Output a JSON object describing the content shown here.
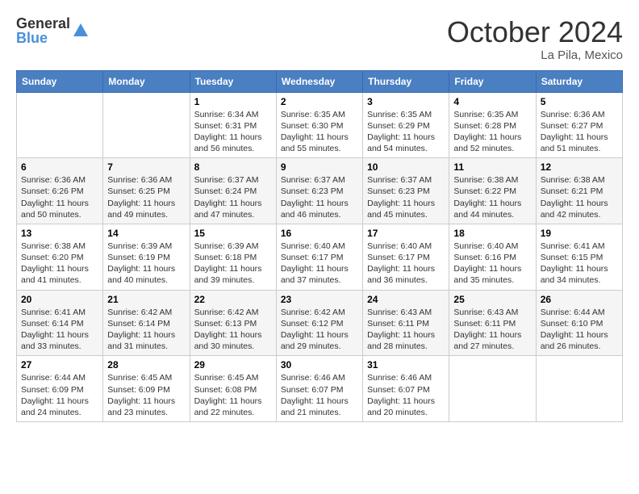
{
  "header": {
    "logo_general": "General",
    "logo_blue": "Blue",
    "title": "October 2024",
    "location": "La Pila, Mexico"
  },
  "days_of_week": [
    "Sunday",
    "Monday",
    "Tuesday",
    "Wednesday",
    "Thursday",
    "Friday",
    "Saturday"
  ],
  "weeks": [
    [
      {
        "day": null,
        "detail": null
      },
      {
        "day": null,
        "detail": null
      },
      {
        "day": "1",
        "sunrise": "Sunrise: 6:34 AM",
        "sunset": "Sunset: 6:31 PM",
        "daylight": "Daylight: 11 hours and 56 minutes."
      },
      {
        "day": "2",
        "sunrise": "Sunrise: 6:35 AM",
        "sunset": "Sunset: 6:30 PM",
        "daylight": "Daylight: 11 hours and 55 minutes."
      },
      {
        "day": "3",
        "sunrise": "Sunrise: 6:35 AM",
        "sunset": "Sunset: 6:29 PM",
        "daylight": "Daylight: 11 hours and 54 minutes."
      },
      {
        "day": "4",
        "sunrise": "Sunrise: 6:35 AM",
        "sunset": "Sunset: 6:28 PM",
        "daylight": "Daylight: 11 hours and 52 minutes."
      },
      {
        "day": "5",
        "sunrise": "Sunrise: 6:36 AM",
        "sunset": "Sunset: 6:27 PM",
        "daylight": "Daylight: 11 hours and 51 minutes."
      }
    ],
    [
      {
        "day": "6",
        "sunrise": "Sunrise: 6:36 AM",
        "sunset": "Sunset: 6:26 PM",
        "daylight": "Daylight: 11 hours and 50 minutes."
      },
      {
        "day": "7",
        "sunrise": "Sunrise: 6:36 AM",
        "sunset": "Sunset: 6:25 PM",
        "daylight": "Daylight: 11 hours and 49 minutes."
      },
      {
        "day": "8",
        "sunrise": "Sunrise: 6:37 AM",
        "sunset": "Sunset: 6:24 PM",
        "daylight": "Daylight: 11 hours and 47 minutes."
      },
      {
        "day": "9",
        "sunrise": "Sunrise: 6:37 AM",
        "sunset": "Sunset: 6:23 PM",
        "daylight": "Daylight: 11 hours and 46 minutes."
      },
      {
        "day": "10",
        "sunrise": "Sunrise: 6:37 AM",
        "sunset": "Sunset: 6:23 PM",
        "daylight": "Daylight: 11 hours and 45 minutes."
      },
      {
        "day": "11",
        "sunrise": "Sunrise: 6:38 AM",
        "sunset": "Sunset: 6:22 PM",
        "daylight": "Daylight: 11 hours and 44 minutes."
      },
      {
        "day": "12",
        "sunrise": "Sunrise: 6:38 AM",
        "sunset": "Sunset: 6:21 PM",
        "daylight": "Daylight: 11 hours and 42 minutes."
      }
    ],
    [
      {
        "day": "13",
        "sunrise": "Sunrise: 6:38 AM",
        "sunset": "Sunset: 6:20 PM",
        "daylight": "Daylight: 11 hours and 41 minutes."
      },
      {
        "day": "14",
        "sunrise": "Sunrise: 6:39 AM",
        "sunset": "Sunset: 6:19 PM",
        "daylight": "Daylight: 11 hours and 40 minutes."
      },
      {
        "day": "15",
        "sunrise": "Sunrise: 6:39 AM",
        "sunset": "Sunset: 6:18 PM",
        "daylight": "Daylight: 11 hours and 39 minutes."
      },
      {
        "day": "16",
        "sunrise": "Sunrise: 6:40 AM",
        "sunset": "Sunset: 6:17 PM",
        "daylight": "Daylight: 11 hours and 37 minutes."
      },
      {
        "day": "17",
        "sunrise": "Sunrise: 6:40 AM",
        "sunset": "Sunset: 6:17 PM",
        "daylight": "Daylight: 11 hours and 36 minutes."
      },
      {
        "day": "18",
        "sunrise": "Sunrise: 6:40 AM",
        "sunset": "Sunset: 6:16 PM",
        "daylight": "Daylight: 11 hours and 35 minutes."
      },
      {
        "day": "19",
        "sunrise": "Sunrise: 6:41 AM",
        "sunset": "Sunset: 6:15 PM",
        "daylight": "Daylight: 11 hours and 34 minutes."
      }
    ],
    [
      {
        "day": "20",
        "sunrise": "Sunrise: 6:41 AM",
        "sunset": "Sunset: 6:14 PM",
        "daylight": "Daylight: 11 hours and 33 minutes."
      },
      {
        "day": "21",
        "sunrise": "Sunrise: 6:42 AM",
        "sunset": "Sunset: 6:14 PM",
        "daylight": "Daylight: 11 hours and 31 minutes."
      },
      {
        "day": "22",
        "sunrise": "Sunrise: 6:42 AM",
        "sunset": "Sunset: 6:13 PM",
        "daylight": "Daylight: 11 hours and 30 minutes."
      },
      {
        "day": "23",
        "sunrise": "Sunrise: 6:42 AM",
        "sunset": "Sunset: 6:12 PM",
        "daylight": "Daylight: 11 hours and 29 minutes."
      },
      {
        "day": "24",
        "sunrise": "Sunrise: 6:43 AM",
        "sunset": "Sunset: 6:11 PM",
        "daylight": "Daylight: 11 hours and 28 minutes."
      },
      {
        "day": "25",
        "sunrise": "Sunrise: 6:43 AM",
        "sunset": "Sunset: 6:11 PM",
        "daylight": "Daylight: 11 hours and 27 minutes."
      },
      {
        "day": "26",
        "sunrise": "Sunrise: 6:44 AM",
        "sunset": "Sunset: 6:10 PM",
        "daylight": "Daylight: 11 hours and 26 minutes."
      }
    ],
    [
      {
        "day": "27",
        "sunrise": "Sunrise: 6:44 AM",
        "sunset": "Sunset: 6:09 PM",
        "daylight": "Daylight: 11 hours and 24 minutes."
      },
      {
        "day": "28",
        "sunrise": "Sunrise: 6:45 AM",
        "sunset": "Sunset: 6:09 PM",
        "daylight": "Daylight: 11 hours and 23 minutes."
      },
      {
        "day": "29",
        "sunrise": "Sunrise: 6:45 AM",
        "sunset": "Sunset: 6:08 PM",
        "daylight": "Daylight: 11 hours and 22 minutes."
      },
      {
        "day": "30",
        "sunrise": "Sunrise: 6:46 AM",
        "sunset": "Sunset: 6:07 PM",
        "daylight": "Daylight: 11 hours and 21 minutes."
      },
      {
        "day": "31",
        "sunrise": "Sunrise: 6:46 AM",
        "sunset": "Sunset: 6:07 PM",
        "daylight": "Daylight: 11 hours and 20 minutes."
      },
      {
        "day": null,
        "detail": null
      },
      {
        "day": null,
        "detail": null
      }
    ]
  ]
}
